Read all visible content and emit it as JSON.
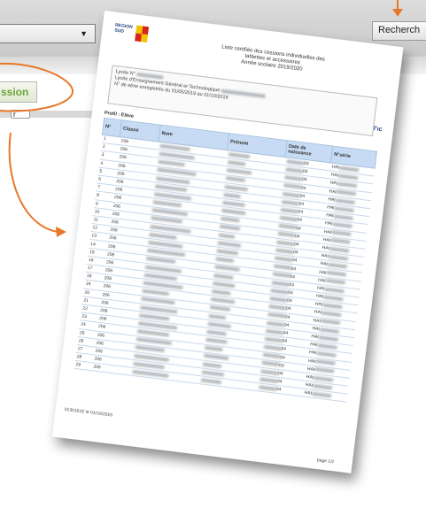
{
  "app": {
    "search_button": "Recherch",
    "session_button": "ssion",
    "small_button": "r"
  },
  "document": {
    "logo_line1": "REGION",
    "logo_line2": "SUD",
    "header_line1": "Liste certifiée des cessions individuelles des",
    "header_line2": "tablettes et accessoires",
    "header_line3": "Année scolaire 2019/2020",
    "info_line1": "Lycée N°",
    "info_line2": "Lycée d'Enseignement Général et Technologique",
    "info_line3": "N° de série enregistrés du 01/05/2019 au 01/10/2019",
    "dc_logo": "l'ıc",
    "profil_label": "Profil : Elève",
    "columns": [
      "N°",
      "Classe",
      "Nom",
      "Prénom",
      "Date de naissance",
      "N°série"
    ],
    "rows": [
      {
        "n": "1",
        "classe": "206",
        "date": "04",
        "serie": "HAt"
      },
      {
        "n": "2",
        "classe": "206",
        "date": "04",
        "serie": "HAt"
      },
      {
        "n": "3",
        "classe": "206",
        "date": "04",
        "serie": "HAt"
      },
      {
        "n": "4",
        "classe": "206",
        "date": "04",
        "serie": "HAt"
      },
      {
        "n": "5",
        "classe": "206",
        "date": "04",
        "serie": "HAt"
      },
      {
        "n": "6",
        "classe": "206",
        "date": "04",
        "serie": "HAt"
      },
      {
        "n": "7",
        "classe": "206",
        "date": "04",
        "serie": "HAt"
      },
      {
        "n": "8",
        "classe": "206",
        "date": "04",
        "serie": "HAt"
      },
      {
        "n": "9",
        "classe": "206",
        "date": "04",
        "serie": "HAt"
      },
      {
        "n": "10",
        "classe": "206",
        "date": "04",
        "serie": "HAt"
      },
      {
        "n": "11",
        "classe": "206",
        "date": "04",
        "serie": "HAt"
      },
      {
        "n": "12",
        "classe": "206",
        "date": "04",
        "serie": "HAt"
      },
      {
        "n": "13",
        "classe": "206",
        "date": "04",
        "serie": "HAt"
      },
      {
        "n": "14",
        "classe": "206",
        "date": "04",
        "serie": "HAt"
      },
      {
        "n": "15",
        "classe": "206",
        "date": "04",
        "serie": "HAt"
      },
      {
        "n": "16",
        "classe": "206",
        "date": "03",
        "serie": "HAt"
      },
      {
        "n": "17",
        "classe": "206",
        "date": "04",
        "serie": "HAt"
      },
      {
        "n": "18",
        "classe": "206",
        "date": "04",
        "serie": "HAt"
      },
      {
        "n": "19",
        "classe": "206",
        "date": "04",
        "serie": "HAt"
      },
      {
        "n": "20",
        "classe": "206",
        "date": "04",
        "serie": "HAt"
      },
      {
        "n": "21",
        "classe": "206",
        "date": "04",
        "serie": "HAt"
      },
      {
        "n": "22",
        "classe": "206",
        "date": "04",
        "serie": "HAt"
      },
      {
        "n": "23",
        "classe": "206",
        "date": "04",
        "serie": "HAt"
      },
      {
        "n": "24",
        "classe": "206",
        "date": "04",
        "serie": "HAt"
      },
      {
        "n": "25",
        "classe": "206",
        "date": "04",
        "serie": "HAt"
      },
      {
        "n": "26",
        "classe": "206",
        "date": "03",
        "serie": "HAt"
      },
      {
        "n": "27",
        "classe": "206",
        "date": "04",
        "serie": "HAt"
      },
      {
        "n": "28",
        "classe": "206",
        "date": "04",
        "serie": "HAt"
      },
      {
        "n": "29",
        "classe": "206",
        "date": "04",
        "serie": "HAt"
      }
    ],
    "footer_left": "0130161E le 01/10/2019",
    "footer_right": "page 1/2"
  },
  "colors": {
    "annotation_orange": "#e8782a",
    "header_blue": "#c7dcf4",
    "session_green": "#6da43a"
  }
}
